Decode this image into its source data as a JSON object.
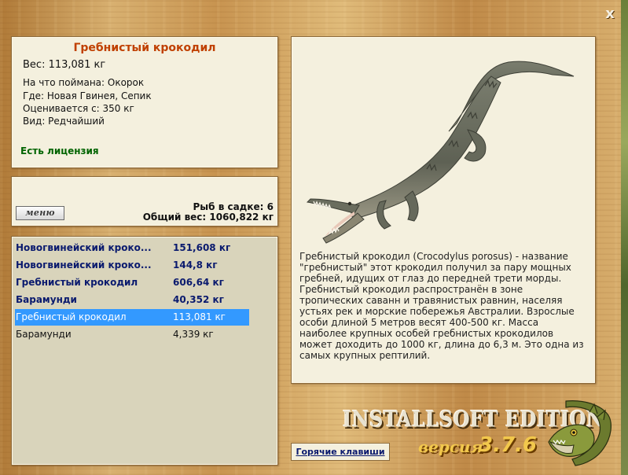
{
  "window": {
    "close_label": "x"
  },
  "fish_info": {
    "title": "Гребнистый крокодил",
    "weight": "Вес: 113,081 кг",
    "bait": "На что поймана: Окорок",
    "location": "Где: Новая Гвинея, Сепик",
    "value": "Оценивается с: 350 кг",
    "rarity": "Вид: Редчайший",
    "license": "Есть лицензия"
  },
  "cage": {
    "menu_label": "меню",
    "count": "Рыб в садке: 6",
    "total_weight": "Общий вес: 1060,822 кг"
  },
  "catch_list": [
    {
      "name": "Новогвинейский кроко...",
      "weight": "151,608 кг",
      "style": "bold"
    },
    {
      "name": "Новогвинейский кроко...",
      "weight": "144,8 кг",
      "style": "bold"
    },
    {
      "name": "Гребнистый крокодил",
      "weight": "606,64 кг",
      "style": "bold"
    },
    {
      "name": "Барамунди",
      "weight": "40,352 кг",
      "style": "bold"
    },
    {
      "name": "Гребнистый крокодил",
      "weight": "113,081 кг",
      "style": "selected"
    },
    {
      "name": "Барамунди",
      "weight": "4,339 кг",
      "style": "normal"
    }
  ],
  "description": {
    "image_icon": "crocodile-image",
    "text": "Гребнистый крокодил (Crocodylus porosus) - название \"гребнистый\" этот крокодил получил за пару мощных гребней, идущих от глаз до передней трети морды. Гребнистый крокодил распространён в зоне тропических саванн и травянистых равнин, населяя устьях рек и морские побережья Австралии. Взрослые особи длиной 5 метров весят 400-500 кг. Масса наиболее крупных особей гребнистых крокодилов может доходить до 1000 кг, длина до 6,3 м. Это одна из самых крупных рептилий."
  },
  "footer": {
    "hotkeys_label": "Горячие клавиши",
    "edition": "INSTALLSOFT EDITION",
    "version_word": "версия",
    "version_number": "3.7.6",
    "logo_icon": "pike-fish-logo"
  },
  "colors": {
    "title": "#c04000",
    "license": "#006400",
    "list_bold": "#0a1a6e",
    "selection": "#3399ff",
    "version": "#f2c84c"
  }
}
